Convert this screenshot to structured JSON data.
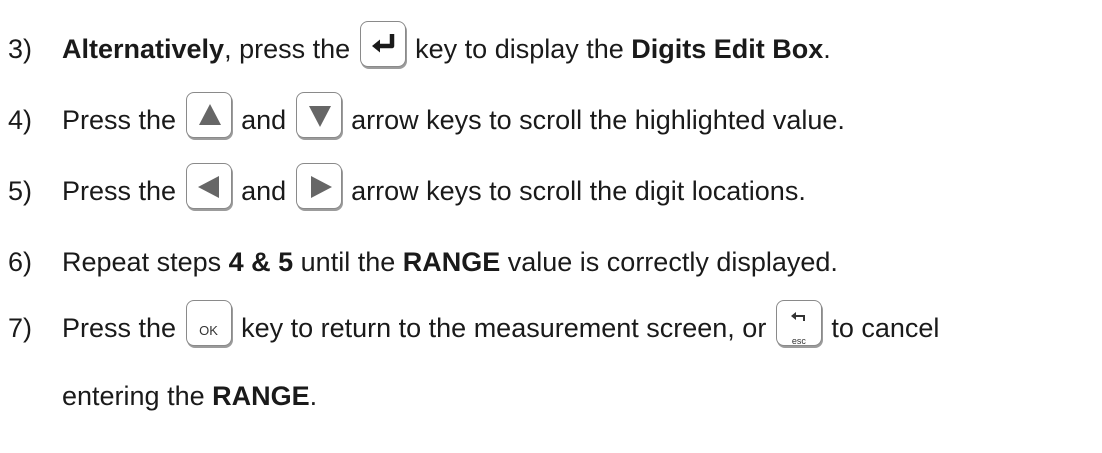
{
  "steps": [
    {
      "num": "3)",
      "bold_lead": "Alternatively",
      "text_a": ", press the ",
      "key": "enter-icon",
      "text_b": " key to display the ",
      "bold_end": "Digits Edit Box",
      "text_end": "."
    },
    {
      "num": "4)",
      "text_a": "Press the ",
      "key_a": "up-arrow-icon",
      "text_mid": " and ",
      "key_b": "down-arrow-icon",
      "text_b": " arrow keys to scroll the highlighted value."
    },
    {
      "num": "5)",
      "text_a": "Press the ",
      "key_a": "left-arrow-icon",
      "text_mid": " and ",
      "key_b": "right-arrow-icon",
      "text_b": " arrow keys to scroll the digit locations."
    },
    {
      "num": "6)",
      "text_a": "Repeat steps ",
      "bold_a": "4 & 5",
      "text_b": " until the ",
      "bold_b": "RANGE",
      "text_c": " value is correctly displayed."
    },
    {
      "num": "7)",
      "text_a": "Press the ",
      "key_ok_label": "OK",
      "text_b": " key to return to the measurement screen, or ",
      "key_esc_label": "esc",
      "text_c": " to cancel",
      "line2_text": "entering the ",
      "line2_bold": "RANGE",
      "line2_end": "."
    }
  ],
  "colors": {
    "text": "#1a1a1a",
    "key_border": "#8a8a8a",
    "key_glyph": "#666666"
  }
}
